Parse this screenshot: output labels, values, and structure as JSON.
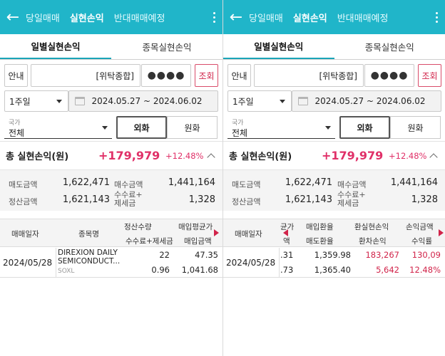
{
  "header": {
    "tabs": [
      "당일매매",
      "실현손익",
      "반대매매예정"
    ],
    "active_tab_index": 1
  },
  "subtabs": [
    "일별실현손익",
    "종목실현손익"
  ],
  "form": {
    "guide_label": "안내",
    "account_type": "[위탁종합]",
    "password_mask": "●●●●",
    "query_label": "조회",
    "period_label": "1주일",
    "date_range": "2024.05.27 ~ 2024.06.02",
    "country_caption": "국가",
    "country_value": "전체",
    "currency_foreign": "외화",
    "currency_won": "원화"
  },
  "summary": {
    "title": "총 실현손익(원)",
    "amount": "+179,979",
    "rate": "+12.48%",
    "sell_label": "매도금액",
    "sell_value": "1,622,471",
    "buy_label": "매수금액",
    "buy_value": "1,441,164",
    "settle_label": "정산금액",
    "settle_value": "1,621,143",
    "fee_label_1": "수수료+",
    "fee_label_2": "제세금",
    "fee_value": "1,328"
  },
  "table_left": {
    "headers": {
      "date": "매매일자",
      "name": "종목명",
      "qty": "정산수량",
      "fee": "수수료+제세금",
      "avg": "매입평균가",
      "buy_amt": "매입금액"
    },
    "row": {
      "date": "2024/05/28",
      "name_1": "DIREXION DAILY",
      "name_2": "SEMICONDUCT...",
      "ticker": "SOXL",
      "qty": "22",
      "fee": "0.96",
      "avg": "47.35",
      "buy_amt": "1,041.68"
    }
  },
  "table_right": {
    "headers": {
      "date": "매매일자",
      "cut_1": "균가",
      "cut_2": "액",
      "buy_fx": "매입환율",
      "sell_fx": "매도환율",
      "fx_profit": "환실현손익",
      "fx_diff": "환차손익",
      "pl_amt": "손익금액",
      "pl_rate": "수익률"
    },
    "row": {
      "date": "2024/05/28",
      "cut_1": ".31",
      "cut_2": ".73",
      "buy_fx": "1,359.98",
      "sell_fx": "1,365.40",
      "fx_profit": "183,267",
      "fx_diff": "5,642",
      "pl_amt": "130,09",
      "pl_rate": "12.48%"
    }
  },
  "colors": {
    "header_bg": "#20b5c9",
    "accent_red": "#d1244a",
    "profit_pink": "#e03068"
  }
}
